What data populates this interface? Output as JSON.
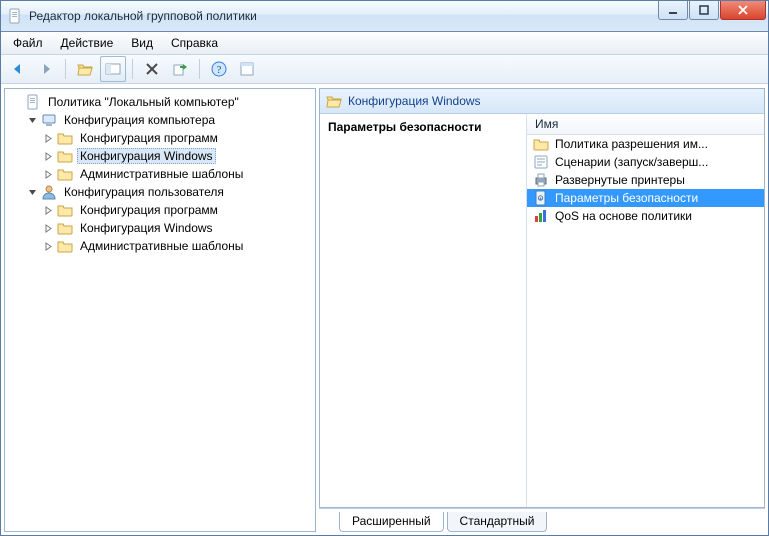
{
  "window": {
    "title": "Редактор локальной групповой политики"
  },
  "menu": {
    "file": "Файл",
    "action": "Действие",
    "view": "Вид",
    "help": "Справка"
  },
  "tree": {
    "root": {
      "label": "Политика \"Локальный компьютер\""
    },
    "comp": {
      "label": "Конфигурация компьютера",
      "progs": "Конфигурация программ",
      "windows": "Конфигурация Windows",
      "templates": "Административные шаблоны"
    },
    "user": {
      "label": "Конфигурация пользователя",
      "progs": "Конфигурация программ",
      "windows": "Конфигурация Windows",
      "templates": "Административные шаблоны"
    }
  },
  "right": {
    "crumb": "Конфигурация Windows",
    "desc_header": "Параметры безопасности",
    "col_name": "Имя",
    "items": {
      "0": "Политика разрешения им...",
      "1": "Сценарии (запуск/заверш...",
      "2": "Развернутые принтеры",
      "3": "Параметры безопасности",
      "4": "QoS на основе политики"
    }
  },
  "tabs": {
    "extended": "Расширенный",
    "standard": "Стандартный"
  }
}
